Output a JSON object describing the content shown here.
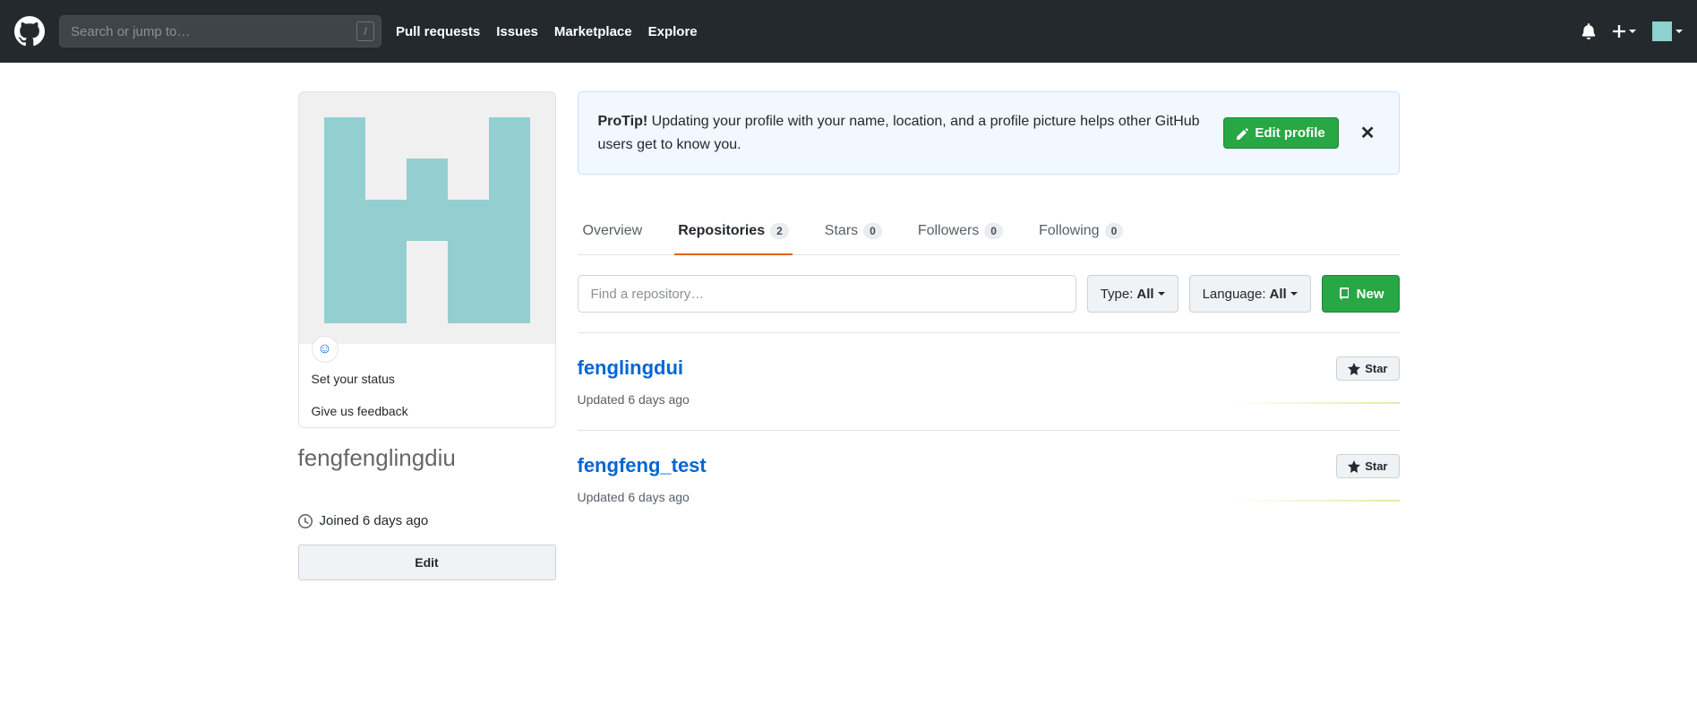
{
  "header": {
    "search_placeholder": "Search or jump to…",
    "nav": [
      "Pull requests",
      "Issues",
      "Marketplace",
      "Explore"
    ]
  },
  "protip": {
    "label": "ProTip!",
    "text": "Updating your profile with your name, location, and a profile picture helps other GitHub users get to know you.",
    "button": "Edit profile"
  },
  "tabs": [
    {
      "label": "Overview",
      "count": null
    },
    {
      "label": "Repositories",
      "count": "2"
    },
    {
      "label": "Stars",
      "count": "0"
    },
    {
      "label": "Followers",
      "count": "0"
    },
    {
      "label": "Following",
      "count": "0"
    }
  ],
  "filters": {
    "find_placeholder": "Find a repository…",
    "type_label": "Type:",
    "type_value": "All",
    "lang_label": "Language:",
    "lang_value": "All",
    "new_button": "New"
  },
  "sidebar": {
    "set_status": "Set your status",
    "feedback": "Give us feedback",
    "username": "fengfenglingdiu",
    "joined": "Joined 6 days ago",
    "edit_button": "Edit"
  },
  "repos": [
    {
      "name": "fenglingdui",
      "updated": "Updated 6 days ago",
      "star_label": "Star"
    },
    {
      "name": "fengfeng_test",
      "updated": "Updated 6 days ago",
      "star_label": "Star"
    }
  ]
}
